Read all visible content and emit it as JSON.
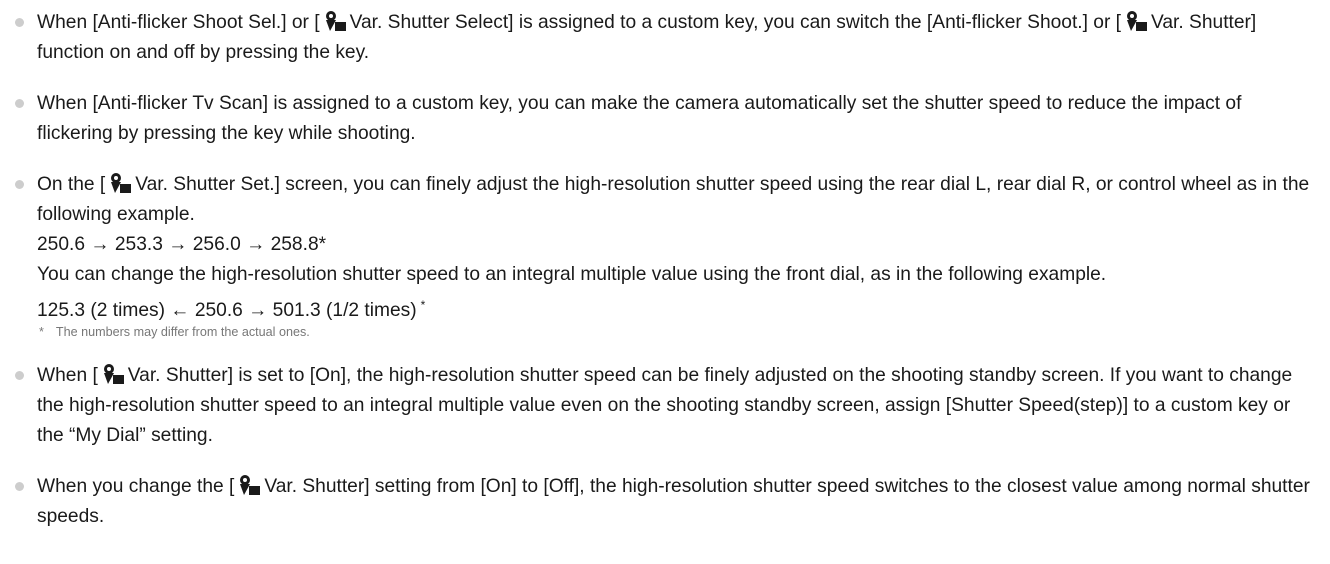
{
  "notes": [
    {
      "p1": "When [Anti-flicker Shoot Sel.] or [",
      "p2": "Var. Shutter Select] is assigned to a custom key, you can switch the [Anti-flicker Shoot.] or [",
      "p3": "Var. Shutter] function on and off by pressing the key."
    },
    {
      "text": "When [Anti-flicker Tv Scan] is assigned to a custom key, you can make the camera automatically set the shutter speed to reduce the impact of flickering by pressing the key while shooting."
    },
    {
      "p1": "On the [",
      "p2": "Var. Shutter Set.] screen, you can finely adjust the high-resolution shutter speed using the rear dial L, rear dial R, or control wheel as in the following example.",
      "example1": "250.6 → 253.3 → 256.0 → 258.8*",
      "p3": "You can change the high-resolution shutter speed to an integral multiple value using the front dial, as in the following example.",
      "example2": "125.3 (2 times) ← 250.6 → 501.3 (1/2 times)",
      "example2_mark": "*",
      "footnote_mark": "*",
      "footnote": "The numbers may differ from the actual ones."
    },
    {
      "p1": "When [",
      "p2": "Var. Shutter] is set to [On], the high-resolution shutter speed can be finely adjusted on the shooting standby screen. If you want to change the high-resolution shutter speed to an integral multiple value even on the shooting standby screen, assign [Shutter Speed(step)] to a custom key or the “My Dial” setting."
    },
    {
      "p1": "When you change the [",
      "p2": "Var. Shutter] setting from [On] to [Off], the high-resolution shutter speed switches to the closest value among normal shutter speeds."
    }
  ]
}
